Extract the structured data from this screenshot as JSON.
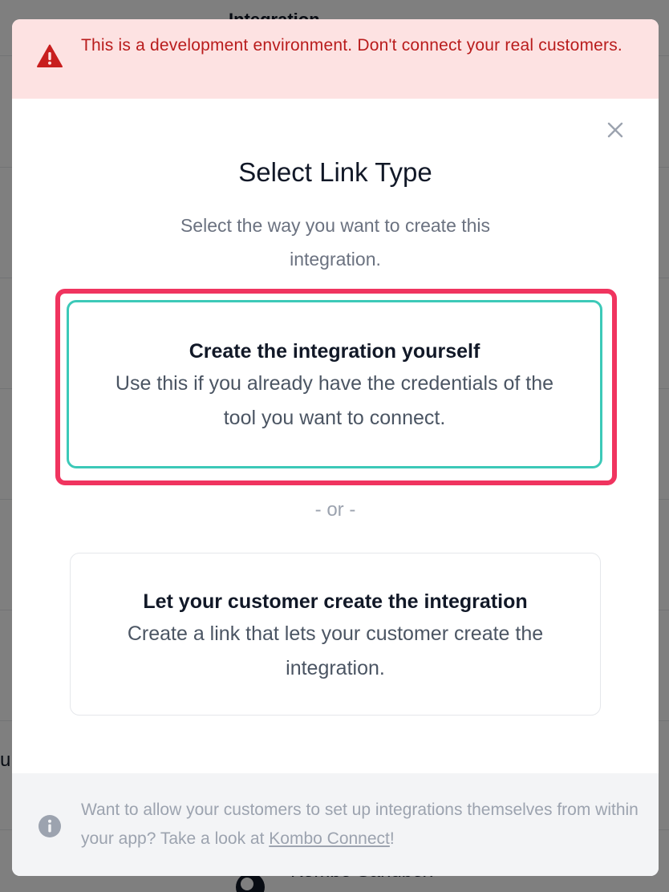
{
  "background": {
    "header_title": "Integration",
    "side_fragment": "u",
    "bottom_item_label": "Kombo Sandbox"
  },
  "modal": {
    "warning": {
      "icon": "warning-triangle-icon",
      "text": "This is a development environment. Don't connect your real customers."
    },
    "close_icon": "close-icon",
    "title": "Select Link Type",
    "subtitle": "Select the way you want to create this integration.",
    "options": [
      {
        "title": "Create the integration yourself",
        "description": "Use this if you already have the credentials of the tool you want to connect.",
        "selected": true
      },
      {
        "title": "Let your customer create the integration",
        "description": "Create a link that lets your customer create the integration.",
        "selected": false
      }
    ],
    "divider_text": "- or -",
    "footer": {
      "icon": "info-icon",
      "text_before": "Want to allow your customers to set up integrations themselves from within your app? Take a look at ",
      "link_text": "Kombo Connect",
      "text_after": "!"
    }
  },
  "colors": {
    "warning_bg": "#fde2e2",
    "warning_text": "#b91c1c",
    "selected_border": "#3cc9b8",
    "highlight_frame": "#f0345f"
  }
}
